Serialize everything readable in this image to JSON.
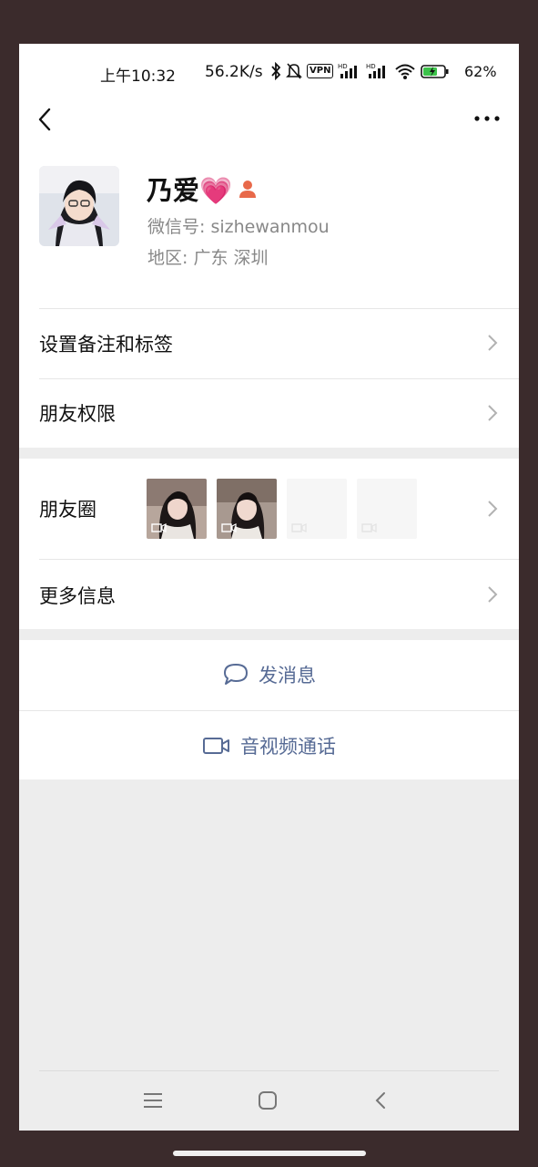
{
  "status_bar": {
    "time": "上午10:32",
    "net_speed": "56.2K/s",
    "vpn": "VPN",
    "signal1_label": "HD",
    "signal2_label": "HD",
    "battery": "62%"
  },
  "profile": {
    "name": "乃爱💗",
    "wechat_id": "微信号: sizhewanmou",
    "region": "地区: 广东  深圳"
  },
  "rows": {
    "remark": "设置备注和标签",
    "permissions": "朋友权限",
    "moments": "朋友圈",
    "more_info": "更多信息"
  },
  "actions": {
    "message": "发消息",
    "call": "音视频通话"
  },
  "icons": {
    "back": "back-chevron-icon",
    "more": "more-dots-icon",
    "contact": "contact-person-icon",
    "chat": "chat-bubble-icon",
    "video": "video-camera-icon"
  },
  "colors": {
    "link": "#576b95",
    "accent_person": "#e8694a"
  }
}
